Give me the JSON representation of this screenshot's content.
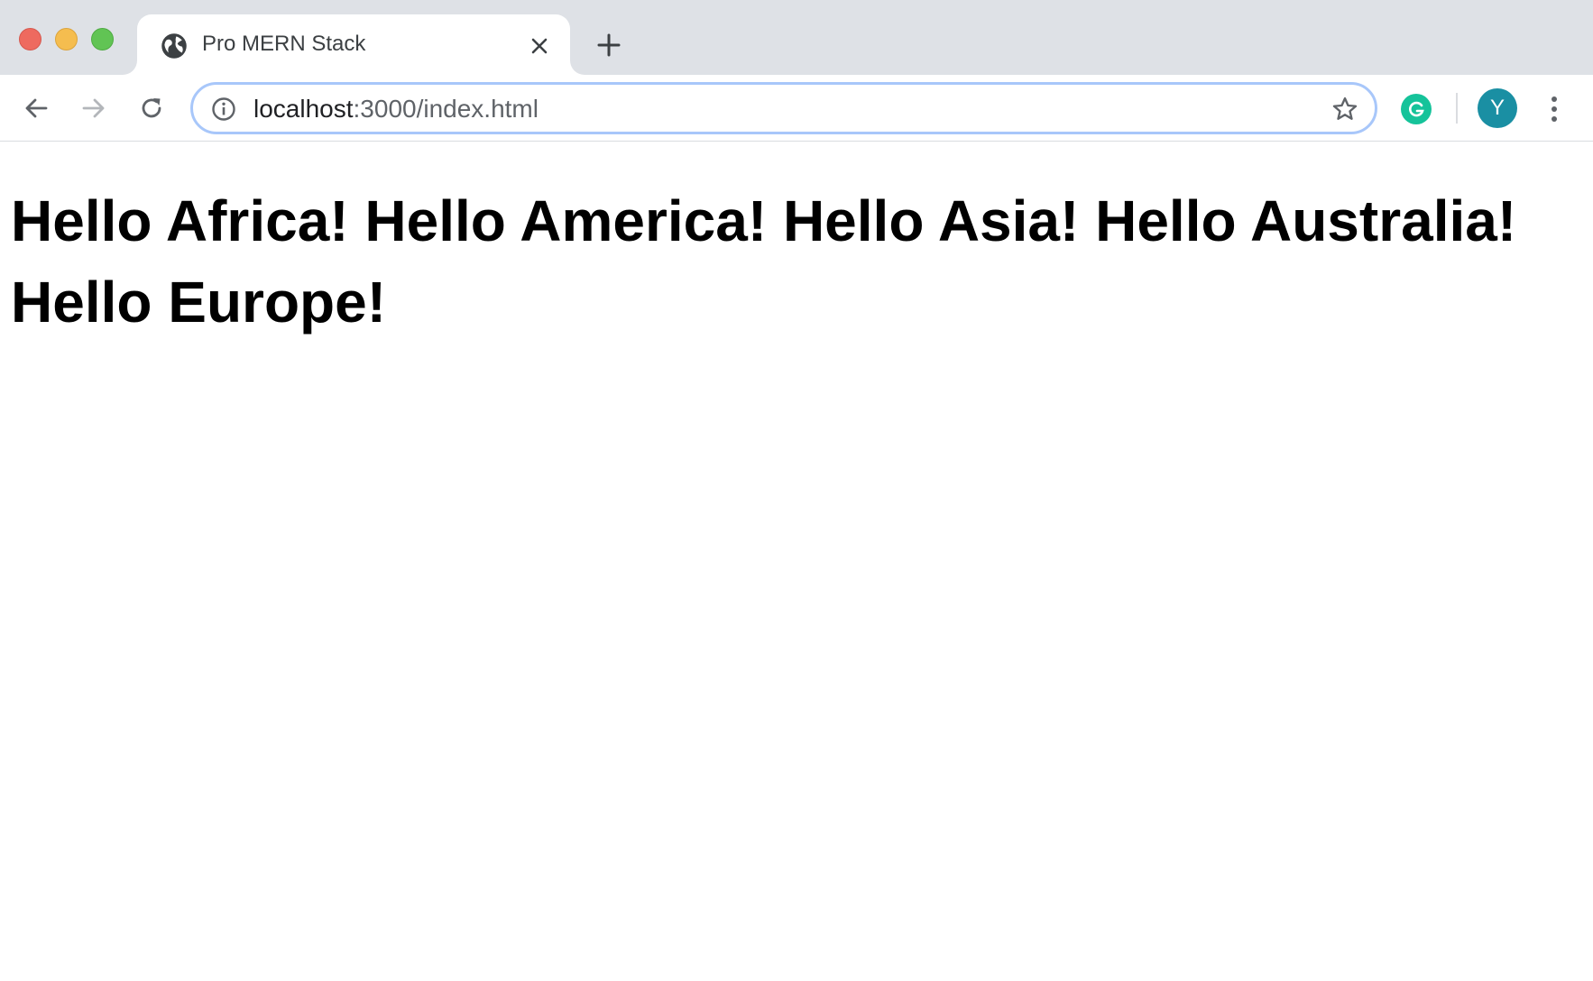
{
  "window": {
    "controls": [
      "close",
      "minimize",
      "zoom"
    ],
    "colors": {
      "close": "#ee6a5f",
      "minimize": "#f5bd4f",
      "zoom": "#61c454"
    }
  },
  "tab": {
    "title": "Pro MERN Stack",
    "favicon": "globe-icon"
  },
  "toolbar": {
    "url_host": "localhost",
    "url_path": ":3000/index.html",
    "profile_initial": "Y",
    "extension_icon": "grammarly-icon",
    "accent": "#a8c7fa",
    "avatar_color": "#1a8fa3"
  },
  "page": {
    "heading": "Hello Africa! Hello America! Hello Asia! Hello Australia! Hello Europe!"
  }
}
